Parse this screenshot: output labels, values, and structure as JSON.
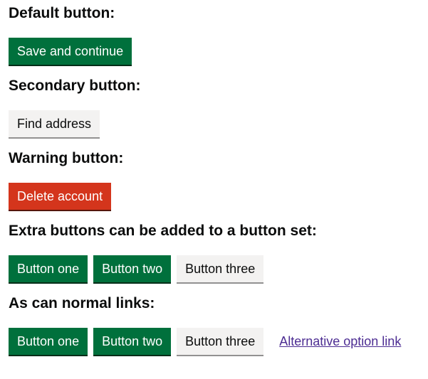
{
  "sections": [
    {
      "heading": "Default button:",
      "buttons": [
        {
          "label": "Save and continue",
          "style": "primary"
        }
      ]
    },
    {
      "heading": "Secondary button:",
      "buttons": [
        {
          "label": "Find address",
          "style": "secondary"
        }
      ]
    },
    {
      "heading": "Warning button:",
      "buttons": [
        {
          "label": "Delete account",
          "style": "warning"
        }
      ]
    },
    {
      "heading": "Extra buttons can be added to a button set:",
      "buttons": [
        {
          "label": "Button one",
          "style": "primary"
        },
        {
          "label": "Button two",
          "style": "primary"
        },
        {
          "label": "Button three",
          "style": "secondary"
        }
      ]
    },
    {
      "heading": "As can normal links:",
      "buttons": [
        {
          "label": "Button one",
          "style": "primary"
        },
        {
          "label": "Button two",
          "style": "primary"
        },
        {
          "label": "Button three",
          "style": "secondary"
        }
      ],
      "link": "Alternative option link"
    }
  ],
  "colors": {
    "primary": "#00703c",
    "secondary": "#f3f2f1",
    "warning": "#d4351c",
    "link": "#4c2c92"
  }
}
